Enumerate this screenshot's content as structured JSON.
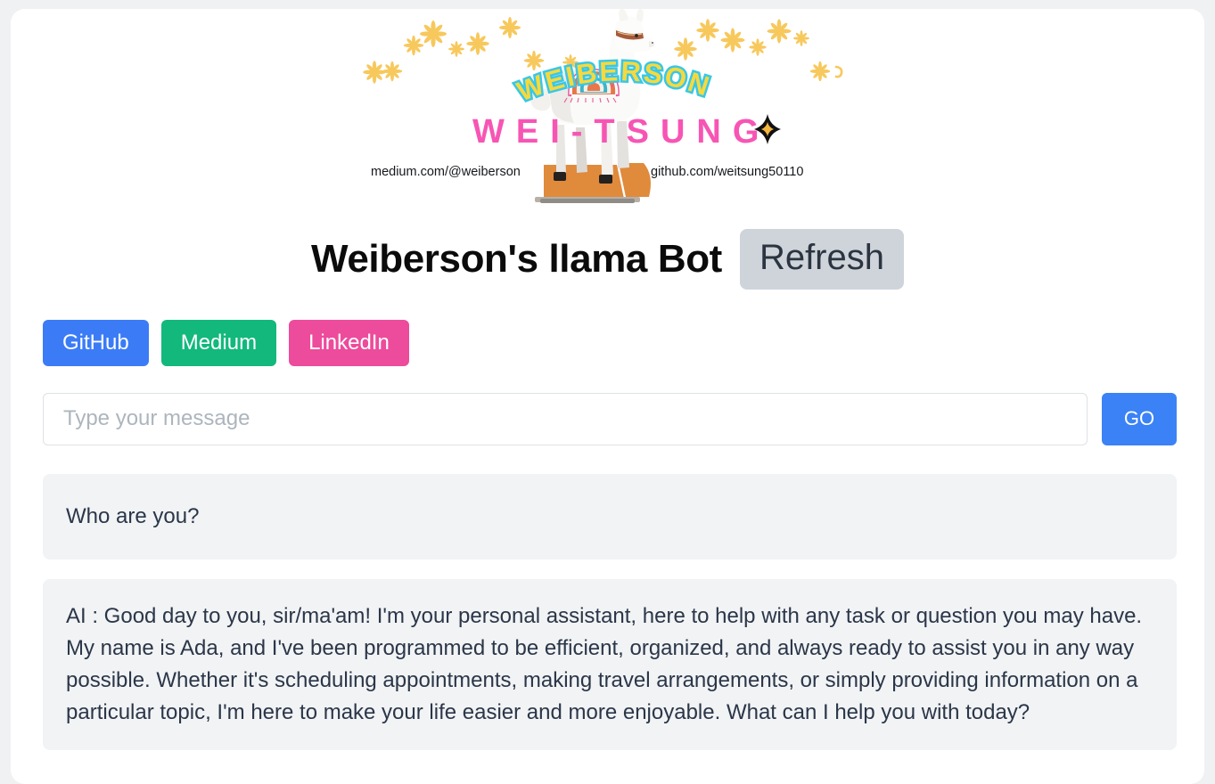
{
  "banner": {
    "brand_top": "WEIBERSON",
    "brand_bottom": "WEI-TSUNG",
    "link_left": "medium.com/@weiberson",
    "link_right": "github.com/weitsung50110",
    "colors": {
      "brand_top_fill": "#F7D93C",
      "brand_top_outline": "#38C7E8",
      "brand_bottom_fill": "#F755B4",
      "flower": "#F7C85C",
      "sparkle": "#111111",
      "sparkle_core": "#F4B63F",
      "base_block": "#E08A3C"
    }
  },
  "header": {
    "title": "Weiberson's llama Bot",
    "refresh_label": "Refresh"
  },
  "links": [
    {
      "label": "GitHub",
      "color": "#3B7CF6"
    },
    {
      "label": "Medium",
      "color": "#12B87C"
    },
    {
      "label": "LinkedIn",
      "color": "#ED4B9C"
    }
  ],
  "composer": {
    "placeholder": "Type your message",
    "value": "",
    "submit_label": "GO",
    "submit_color": "#3B82F6"
  },
  "chat": {
    "messages": [
      {
        "role": "user",
        "text": "Who are you?"
      },
      {
        "role": "assistant",
        "text": "AI : Good day to you, sir/ma'am! I'm your personal assistant, here to help with any task or question you may have. My name is Ada, and I've been programmed to be efficient, organized, and always ready to assist you in any way possible. Whether it's scheduling appointments, making travel arrangements, or simply providing information on a particular topic, I'm here to make your life easier and more enjoyable. What can I help you with today?"
      }
    ]
  }
}
